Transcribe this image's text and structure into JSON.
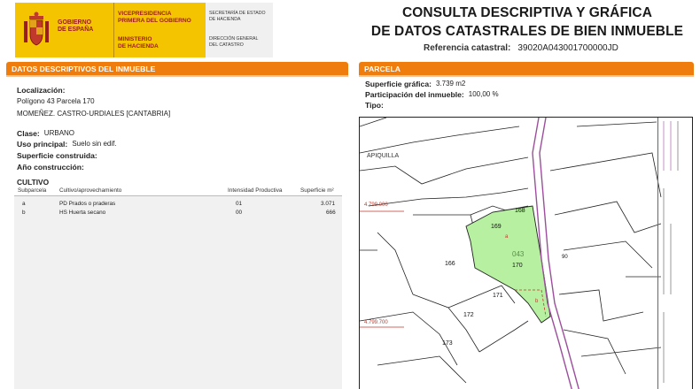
{
  "header": {
    "gov_lines": [
      "GOBIERNO",
      "DE ESPAÑA"
    ],
    "vice_lines": [
      "VICEPRESIDENCIA",
      "PRIMERA DEL GOBIERNO"
    ],
    "ministry_lines": [
      "MINISTERIO",
      "DE HACIENDA"
    ],
    "secretaria_lines": [
      "SECRETARÍA DE ESTADO",
      "DE HACIENDA"
    ],
    "direccion_lines": [
      "DIRECCIÓN GENERAL",
      "DEL CATASTRO"
    ],
    "title_line1": "CONSULTA DESCRIPTIVA Y GRÁFICA",
    "title_line2": "DE DATOS CATASTRALES DE BIEN INMUEBLE",
    "ref_label": "Referencia catastral:",
    "ref_value": "39020A043001700000JD"
  },
  "left": {
    "section_title": "DATOS DESCRIPTIVOS DEL INMUEBLE",
    "localizacion_label": "Localización:",
    "localizacion_line1": "Polígono 43 Parcela 170",
    "localizacion_line2": "MOMEÑEZ. CASTRO-URDIALES [CANTABRIA]",
    "clase_label": "Clase:",
    "clase_value": "URBANO",
    "uso_label": "Uso principal:",
    "uso_value": "Suelo sin edif.",
    "superficie_label": "Superficie construida:",
    "anio_label": "Año construcción:",
    "cultivo_title": "CULTIVO",
    "cultivo_headers": [
      "Subparcela",
      "Cultivo/aprovechamiento",
      "Intensidad Productiva",
      "Superficie m²"
    ],
    "cultivo_rows": [
      [
        "a",
        "PD Prados o praderas",
        "01",
        "3.071"
      ],
      [
        "b",
        "HS Huerta secano",
        "00",
        "666"
      ]
    ]
  },
  "right": {
    "section_title": "PARCELA",
    "sup_grafica_label": "Superficie gráfica:",
    "sup_grafica_value": "3.739 m2",
    "participacion_label": "Participación del inmueble:",
    "participacion_value": "100,00 %",
    "tipo_label": "Tipo:",
    "map": {
      "place_label": "APIQUILLA",
      "coord_top": "4.799.000",
      "coord_bottom": "4.799.700",
      "parcel_labels": [
        "168",
        "169",
        "166",
        "043",
        "170",
        "171",
        "172",
        "173",
        "90",
        "a",
        "b"
      ]
    }
  },
  "colors": {
    "accent_orange": "#ef7d0e",
    "logo_yellow": "#f5c400",
    "parcel_green": "#b6f0a0",
    "road_purple": "#9b4f9b"
  }
}
